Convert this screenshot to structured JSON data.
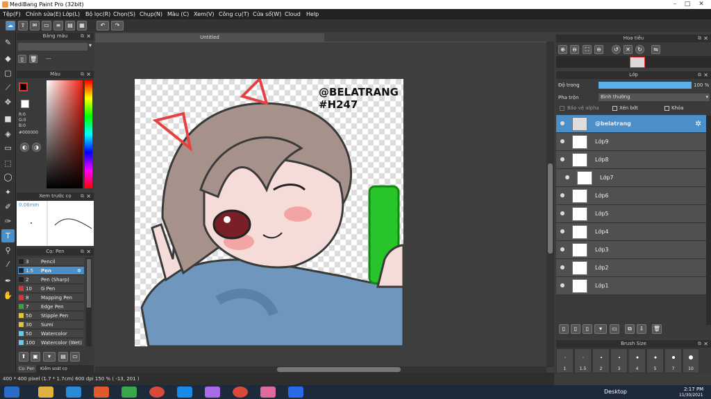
{
  "titlebar": {
    "title": "MediBang Paint Pro (32bit)"
  },
  "menu": [
    "Tệp(F)",
    "Chỉnh sửa(E)",
    "Lớp(L)",
    "Bộ lọc(R)",
    "Chọn(S)",
    "Chụp(N)",
    "Màu (C)",
    "Xem(V)",
    "Công cụ(T)",
    "Cửa sổ(W)",
    "Cloud",
    "Help"
  ],
  "left_panels": {
    "palette_title": "Bảng màu",
    "palette_value": "---",
    "color_title": "Màu",
    "rgb": {
      "r": "R:0",
      "g": "G:0",
      "b": "B:0",
      "hex": "#000000"
    },
    "preview_title": "Xem trước cọ",
    "preview_size": "0.06mm",
    "brush_title": "Cọ: Pen",
    "brushes": [
      {
        "size": "3",
        "name": "Pencil",
        "color": "#222222"
      },
      {
        "size": "1.5",
        "name": "Pen",
        "color": "#222222"
      },
      {
        "size": "2",
        "name": "Pen (Sharp)",
        "color": "#222222"
      },
      {
        "size": "10",
        "name": "G Pen",
        "color": "#dd3333"
      },
      {
        "size": "8",
        "name": "Mapping Pen",
        "color": "#dd3333"
      },
      {
        "size": "7",
        "name": "Edge Pen",
        "color": "#33aa33"
      },
      {
        "size": "50",
        "name": "Stipple Pen",
        "color": "#e8c820"
      },
      {
        "size": "30",
        "name": "Sumi",
        "color": "#e8c820"
      },
      {
        "size": "50",
        "name": "Watercolor",
        "color": "#66ccee"
      },
      {
        "size": "100",
        "name": "Watercolor (Wet)",
        "color": "#66ccee"
      }
    ],
    "tabs": [
      "Cọ: Pen",
      "Kiểm soát cọ"
    ]
  },
  "canvas": {
    "tab_title": "Untitled",
    "art_text_1": "@BELATRANG",
    "art_text_2": "#H247"
  },
  "navigator": {
    "title": "Hoa tiêu"
  },
  "layers": {
    "title": "Lớp",
    "opacity_label": "Độ trong",
    "opacity_value": "100 %",
    "blend_label": "Pha trộn",
    "blend_value": "Bình thường",
    "protect_alpha": "Bảo vệ alpha",
    "clip": "Xén bớt",
    "lock": "Khóa",
    "items": [
      "@belatrang",
      "Lớp9",
      "Lớp8",
      "Lớp7",
      "Lớp6",
      "Lớp5",
      "Lớp4",
      "Lớp3",
      "Lớp2",
      "Lớp1"
    ]
  },
  "brush_size": {
    "title": "Brush Size",
    "sizes": [
      "1",
      "1.5",
      "2",
      "3",
      "4",
      "5",
      "7",
      "10"
    ]
  },
  "status": {
    "text": "400 * 400 pixel   (1.7 * 1.7cm)  600 dpi  150 %  ( -13, 201 )"
  },
  "taskbar": {
    "desktop": "Desktop",
    "time": "2:17 PM",
    "date": "11/30/2021"
  },
  "colors": {
    "accent": "#4a8fc8",
    "bg": "#3c3c3c",
    "panel": "#3a3a3a"
  }
}
